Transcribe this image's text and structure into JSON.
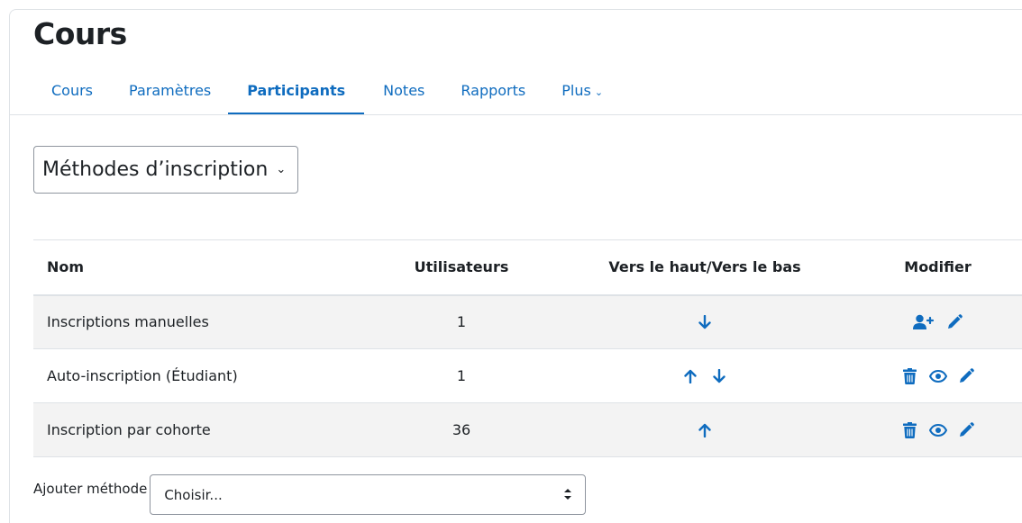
{
  "page": {
    "title": "Cours"
  },
  "tabs": [
    {
      "label": "Cours"
    },
    {
      "label": "Paramètres"
    },
    {
      "label": "Participants"
    },
    {
      "label": "Notes"
    },
    {
      "label": "Rapports"
    },
    {
      "label": "Plus"
    }
  ],
  "active_tab": "Participants",
  "tertiary_nav": {
    "selected": "Méthodes d’inscription"
  },
  "table": {
    "headers": {
      "name": "Nom",
      "users": "Utilisateurs",
      "updown": "Vers le haut/Vers le bas",
      "edit": "Modifier"
    },
    "rows": [
      {
        "name": "Inscriptions manuelles",
        "users": "1",
        "move": [
          "down"
        ],
        "actions": [
          "enrol-users",
          "edit"
        ]
      },
      {
        "name": "Auto-inscription (Étudiant)",
        "users": "1",
        "move": [
          "up",
          "down"
        ],
        "actions": [
          "delete",
          "hide",
          "edit"
        ]
      },
      {
        "name": "Inscription par cohorte",
        "users": "36",
        "move": [
          "up"
        ],
        "actions": [
          "delete",
          "hide",
          "edit"
        ]
      }
    ]
  },
  "add_method": {
    "label": "Ajouter méthode",
    "selected": "Choisir..."
  },
  "colors": {
    "link": "#0f6cbf",
    "text": "#1d2125",
    "border": "#dee2e6",
    "stripe": "#f3f3f3"
  }
}
